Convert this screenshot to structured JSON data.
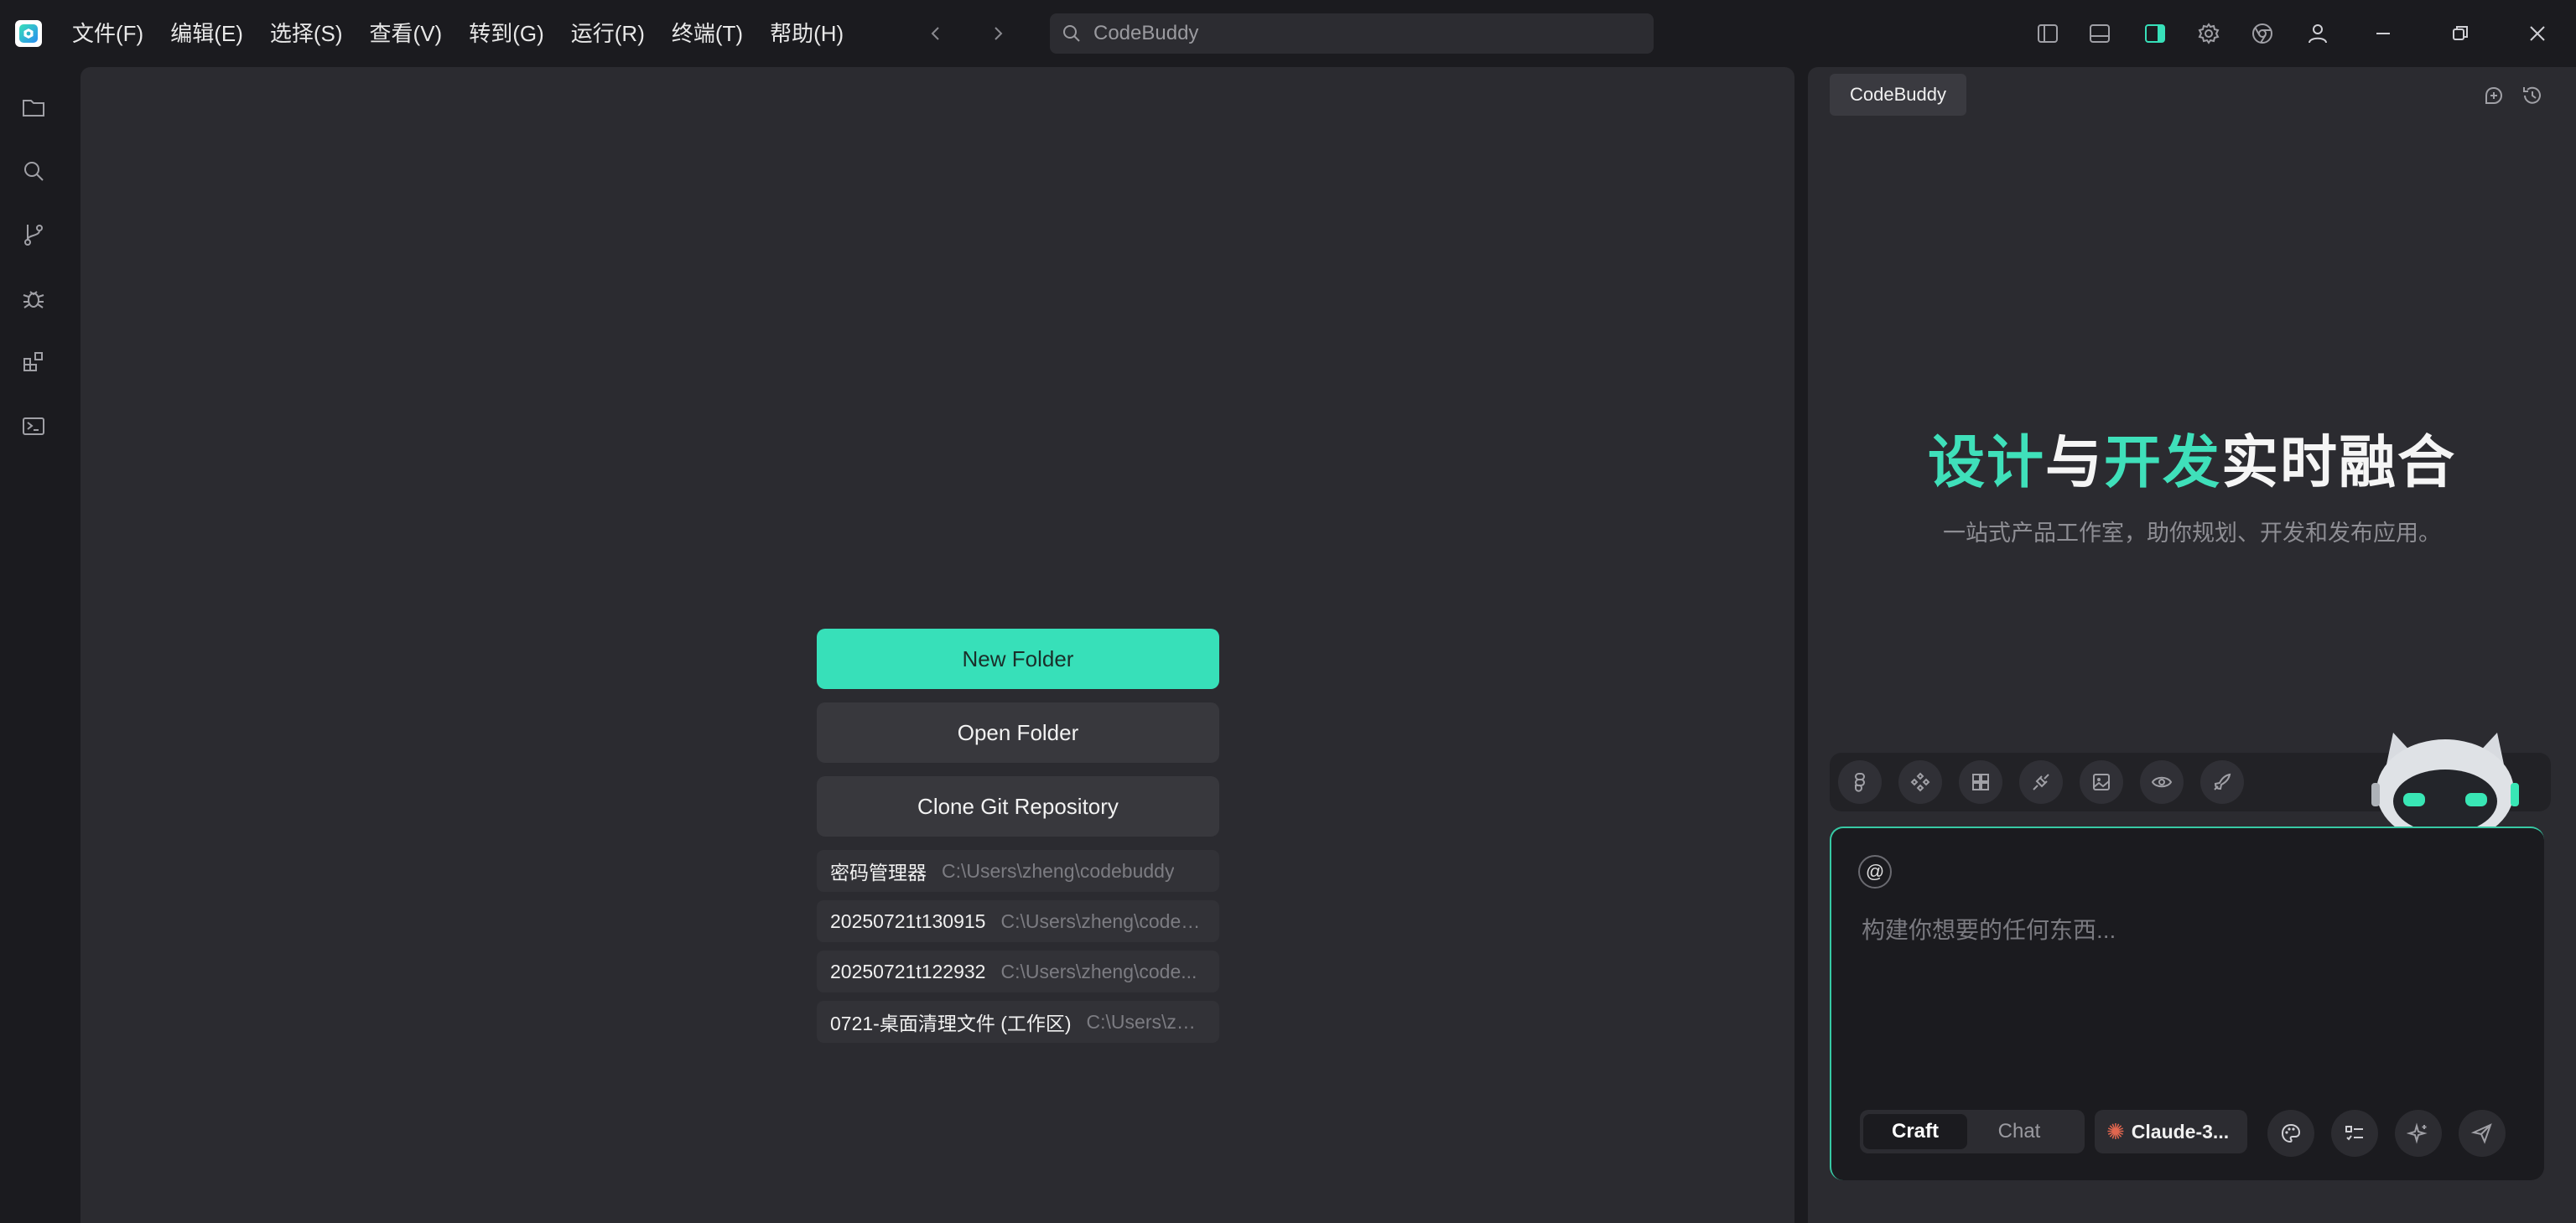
{
  "menu": [
    "文件(F)",
    "编辑(E)",
    "选择(S)",
    "查看(V)",
    "转到(G)",
    "运行(R)",
    "终端(T)",
    "帮助(H)"
  ],
  "search": {
    "label": "CodeBuddy"
  },
  "titlebar_icons": [
    "sidebar-left-icon",
    "panel-bottom-icon",
    "sidebar-right-icon",
    "settings-icon",
    "browser-icon",
    "account-icon"
  ],
  "window_controls": [
    "minimize-icon",
    "restore-icon",
    "close-icon"
  ],
  "activity_icons": [
    "explorer-icon",
    "search-icon",
    "source-control-icon",
    "debug-icon",
    "extensions-icon",
    "terminal-icon"
  ],
  "welcome": {
    "new_folder": "New Folder",
    "open_folder": "Open Folder",
    "clone_repo": "Clone Git Repository",
    "recent": [
      {
        "name": "密码管理器",
        "path": "C:\\Users\\zheng\\codebuddy"
      },
      {
        "name": "20250721t130915",
        "path": "C:\\Users\\zheng\\codeb..."
      },
      {
        "name": "20250721t122932",
        "path": "C:\\Users\\zheng\\code..."
      },
      {
        "name": "0721-桌面清理文件 (工作区)",
        "path": "C:\\Users\\zhe..."
      }
    ]
  },
  "panel": {
    "tab": "CodeBuddy",
    "hero": {
      "part1": "设计",
      "part2": "与",
      "part3": "开发",
      "part4": "实时融合"
    },
    "subtitle": "一站式产品工作室，助你规划、开发和发布应用。",
    "tools": [
      "figma-icon",
      "components-icon",
      "blocks-icon",
      "plugin-icon",
      "image-icon",
      "preview-icon",
      "deploy-icon"
    ],
    "composer": {
      "at_label": "@",
      "placeholder": "构建你想要的任何东西...",
      "modes": [
        "Craft",
        "Chat"
      ],
      "active_mode": "Craft",
      "model": "Claude-3..."
    }
  },
  "colors": {
    "accent": "#37e0b9",
    "background": "#1b1b1f",
    "surface": "#2b2b30"
  }
}
